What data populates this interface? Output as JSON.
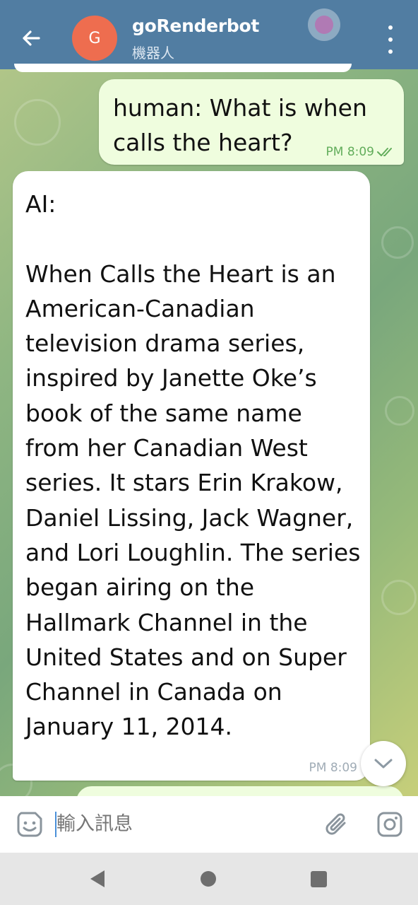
{
  "header": {
    "avatar_letter": "G",
    "title": "goRenderbot",
    "subtitle": "機器人",
    "avatar_color": "#ee6d4f",
    "bar_color": "#517da2"
  },
  "messages": [
    {
      "direction": "outgoing",
      "text": "human: What is when calls the heart?",
      "time": "PM 8:09",
      "status": "read"
    },
    {
      "direction": "incoming",
      "text": "AI:\n\nWhen Calls the Heart is an American-Canadian television drama series, inspired by Janette Oke’s book of the same name from her Canadian West series. It stars Erin Krakow, Daniel Lissing, Jack Wagner, and Lori Loughlin. The series began airing on the Hallmark Channel in the United States and on Super Channel in Canada on January 11, 2014.",
      "time": "PM 8:09"
    }
  ],
  "composer": {
    "placeholder": "輸入訊息"
  },
  "icons": {
    "back": "arrow-left-icon",
    "menu": "more-vertical-icon",
    "emoji": "sticker-emoji-icon",
    "attach": "paperclip-icon",
    "camera": "camera-icon",
    "scroll": "chevron-down-icon"
  }
}
